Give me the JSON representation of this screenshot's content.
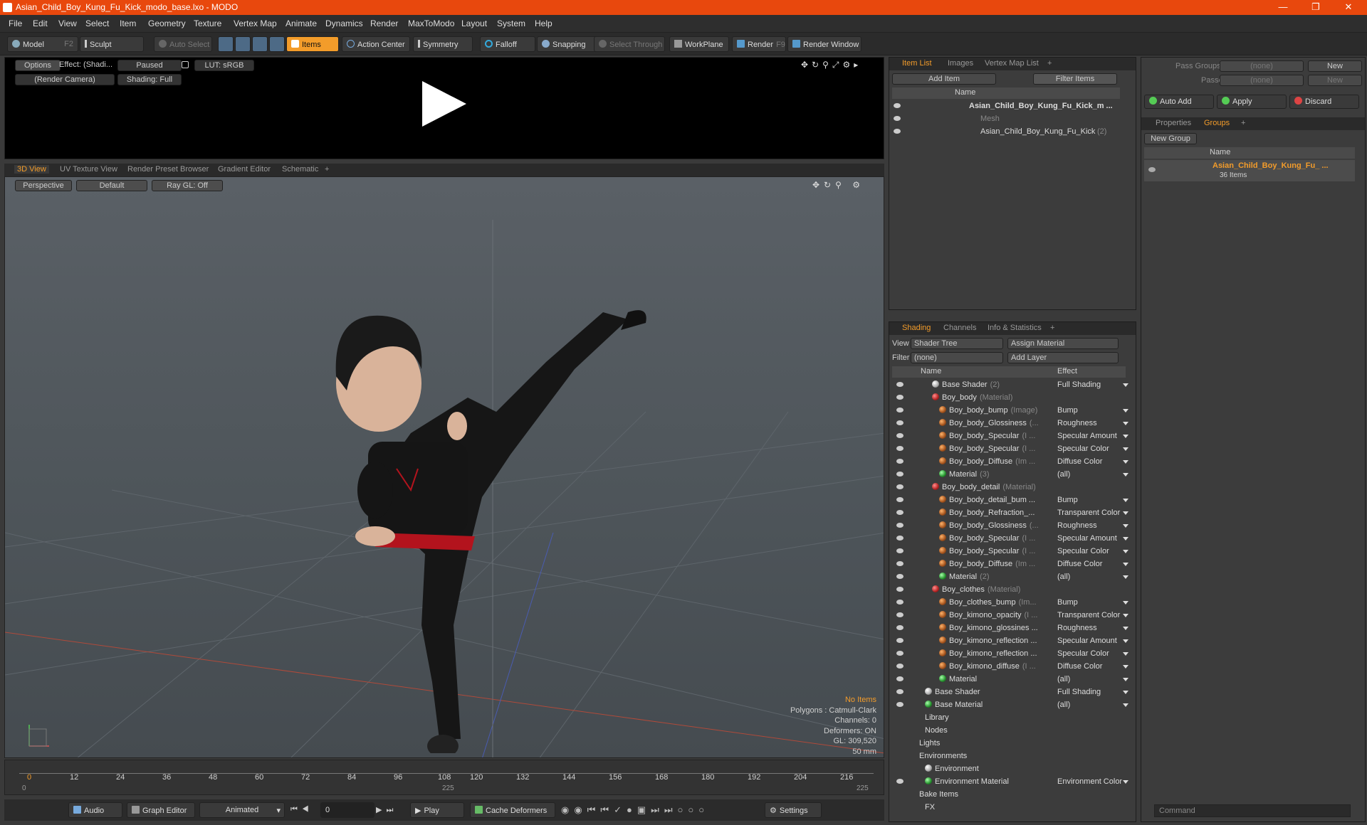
{
  "window": {
    "title": "Asian_Child_Boy_Kung_Fu_Kick_modo_base.lxo - MODO"
  },
  "menu": [
    "File",
    "Edit",
    "View",
    "Select",
    "Item",
    "Geometry",
    "Texture",
    "Vertex Map",
    "Animate",
    "Dynamics",
    "Render",
    "MaxToModo",
    "Layout",
    "System",
    "Help"
  ],
  "toolbar": {
    "model": "Model",
    "model_key": "F2",
    "sculpt": "Sculpt",
    "auto_select": "Auto Select",
    "items": "Items",
    "action_center": "Action Center",
    "symmetry": "Symmetry",
    "falloff": "Falloff",
    "snapping": "Snapping",
    "select_through": "Select Through",
    "workplane": "WorkPlane",
    "render": "Render",
    "render_key": "F9",
    "render_window": "Render Window"
  },
  "preview": {
    "options": "Options",
    "effect": "Effect: (Shadi...",
    "paused": "Paused",
    "lut": "LUT: sRGB",
    "camera": "(Render Camera)",
    "shading": "Shading: Full"
  },
  "viewport_tabs": [
    "3D View",
    "UV Texture View",
    "Render Preset Browser",
    "Gradient Editor",
    "Schematic"
  ],
  "viewport": {
    "perspective": "Perspective",
    "default": "Default",
    "raygl": "Ray GL: Off",
    "stats": {
      "no_items": "No Items",
      "polygons": "Polygons : Catmull-Clark",
      "channels": "Channels: 0",
      "deformers": "Deformers: ON",
      "gl": "GL: 309,520",
      "lens": "50 mm"
    }
  },
  "timeline": {
    "ticks": [
      "0",
      "12",
      "24",
      "36",
      "48",
      "60",
      "72",
      "84",
      "96",
      "108",
      "120",
      "132",
      "144",
      "156",
      "168",
      "180",
      "192",
      "204",
      "216"
    ],
    "start": "0",
    "mid": "225",
    "end": "225"
  },
  "transport": {
    "audio": "Audio",
    "graph_editor": "Graph Editor",
    "animated": "Animated",
    "frame": "0",
    "play": "Play",
    "cache": "Cache Deformers",
    "settings": "Settings"
  },
  "item_list": {
    "tabs": [
      "Item List",
      "Images",
      "Vertex Map List"
    ],
    "add_item": "Add Item",
    "filter": "Filter Items",
    "name_header": "Name",
    "items": [
      {
        "name": "Asian_Child_Boy_Kung_Fu_Kick_m ...",
        "bold": true
      },
      {
        "name": "Mesh",
        "dim": true
      },
      {
        "name": "Asian_Child_Boy_Kung_Fu_Kick",
        "suffix": "(2)"
      }
    ]
  },
  "shading": {
    "tabs": [
      "Shading",
      "Channels",
      "Info & Statistics"
    ],
    "view_label": "View",
    "view_value": "Shader Tree",
    "assign": "Assign Material",
    "filter_label": "Filter",
    "filter_value": "(none)",
    "add_layer": "Add Layer",
    "col_name": "Name",
    "col_effect": "Effect",
    "rows": [
      {
        "indent": 1,
        "ball": "wh",
        "name": "Base Shader",
        "suffix": "(2)",
        "effect": "Full Shading"
      },
      {
        "indent": 1,
        "ball": "rd",
        "name": "Boy_body",
        "suffix": "(Material)",
        "effect": "",
        "arrow": true
      },
      {
        "indent": 2,
        "ball": "or",
        "name": "Boy_body_bump",
        "suffix": "(Image)",
        "effect": "Bump"
      },
      {
        "indent": 2,
        "ball": "or",
        "name": "Boy_body_Glossiness",
        "suffix": "(...",
        "effect": "Roughness"
      },
      {
        "indent": 2,
        "ball": "or",
        "name": "Boy_body_Specular",
        "suffix": "(I ...",
        "effect": "Specular Amount"
      },
      {
        "indent": 2,
        "ball": "or",
        "name": "Boy_body_Specular",
        "suffix": "(I ...",
        "effect": "Specular Color"
      },
      {
        "indent": 2,
        "ball": "or",
        "name": "Boy_body_Diffuse",
        "suffix": "(Im ...",
        "effect": "Diffuse Color"
      },
      {
        "indent": 2,
        "ball": "gr",
        "name": "Material",
        "suffix": "(3)",
        "effect": "(all)"
      },
      {
        "indent": 1,
        "ball": "rd",
        "name": "Boy_body_detail",
        "suffix": "(Material)",
        "effect": "",
        "arrow": true
      },
      {
        "indent": 2,
        "ball": "or",
        "name": "Boy_body_detail_bum ...",
        "suffix": "",
        "effect": "Bump"
      },
      {
        "indent": 2,
        "ball": "or",
        "name": "Boy_body_Refraction_...",
        "suffix": "",
        "effect": "Transparent Color"
      },
      {
        "indent": 2,
        "ball": "or",
        "name": "Boy_body_Glossiness",
        "suffix": "(...",
        "effect": "Roughness"
      },
      {
        "indent": 2,
        "ball": "or",
        "name": "Boy_body_Specular",
        "suffix": "(I ...",
        "effect": "Specular Amount"
      },
      {
        "indent": 2,
        "ball": "or",
        "name": "Boy_body_Specular",
        "suffix": "(I ...",
        "effect": "Specular Color"
      },
      {
        "indent": 2,
        "ball": "or",
        "name": "Boy_body_Diffuse",
        "suffix": "(Im ...",
        "effect": "Diffuse Color"
      },
      {
        "indent": 2,
        "ball": "gr",
        "name": "Material",
        "suffix": "(2)",
        "effect": "(all)"
      },
      {
        "indent": 1,
        "ball": "rd",
        "name": "Boy_clothes",
        "suffix": "(Material)",
        "effect": "",
        "arrow": true
      },
      {
        "indent": 2,
        "ball": "or",
        "name": "Boy_clothes_bump",
        "suffix": "(Im...",
        "effect": "Bump"
      },
      {
        "indent": 2,
        "ball": "or",
        "name": "Boy_kimono_opacity",
        "suffix": "(I ...",
        "effect": "Transparent Color"
      },
      {
        "indent": 2,
        "ball": "or",
        "name": "Boy_kimono_glossines ...",
        "suffix": "",
        "effect": "Roughness"
      },
      {
        "indent": 2,
        "ball": "or",
        "name": "Boy_kimono_reflection ...",
        "suffix": "",
        "effect": "Specular Amount"
      },
      {
        "indent": 2,
        "ball": "or",
        "name": "Boy_kimono_reflection ...",
        "suffix": "",
        "effect": "Specular Color"
      },
      {
        "indent": 2,
        "ball": "or",
        "name": "Boy_kimono_diffuse",
        "suffix": "(I ...",
        "effect": "Diffuse Color"
      },
      {
        "indent": 2,
        "ball": "gr",
        "name": "Material",
        "suffix": "",
        "effect": "(all)"
      },
      {
        "indent": 0,
        "ball": "wh",
        "name": "Base Shader",
        "suffix": "",
        "effect": "Full Shading"
      },
      {
        "indent": 0,
        "ball": "gr",
        "name": "Base Material",
        "suffix": "",
        "effect": "(all)"
      },
      {
        "indent": -1,
        "ball": "",
        "name": "Library",
        "suffix": "",
        "effect": ""
      },
      {
        "indent": -1,
        "ball": "",
        "name": "Nodes",
        "suffix": "",
        "effect": ""
      },
      {
        "indent": -2,
        "ball": "",
        "name": "Lights",
        "suffix": "",
        "effect": ""
      },
      {
        "indent": -2,
        "ball": "",
        "name": "Environments",
        "suffix": "",
        "effect": ""
      },
      {
        "indent": -1,
        "ball": "wh",
        "name": "Environment",
        "suffix": "",
        "effect": ""
      },
      {
        "indent": 0,
        "ball": "gr",
        "name": "Environment Material",
        "suffix": "",
        "effect": "Environment Color"
      },
      {
        "indent": -2,
        "ball": "",
        "name": "Bake Items",
        "suffix": "",
        "effect": ""
      },
      {
        "indent": -1,
        "ball": "",
        "name": "FX",
        "suffix": "",
        "effect": ""
      }
    ]
  },
  "right": {
    "pass_groups": "Pass Groups",
    "passes": "Passes",
    "none": "(none)",
    "new": "New",
    "auto_add": "Auto Add",
    "apply": "Apply",
    "discard": "Discard",
    "tabs": [
      "Properties",
      "Groups"
    ],
    "new_group": "New Group",
    "name_header": "Name",
    "group_name": "Asian_Child_Boy_Kung_Fu_ ...",
    "group_count": "36 Items",
    "command": "Command"
  },
  "colors": {
    "accent": "#f39c2a",
    "titlebar": "#e8480d"
  }
}
